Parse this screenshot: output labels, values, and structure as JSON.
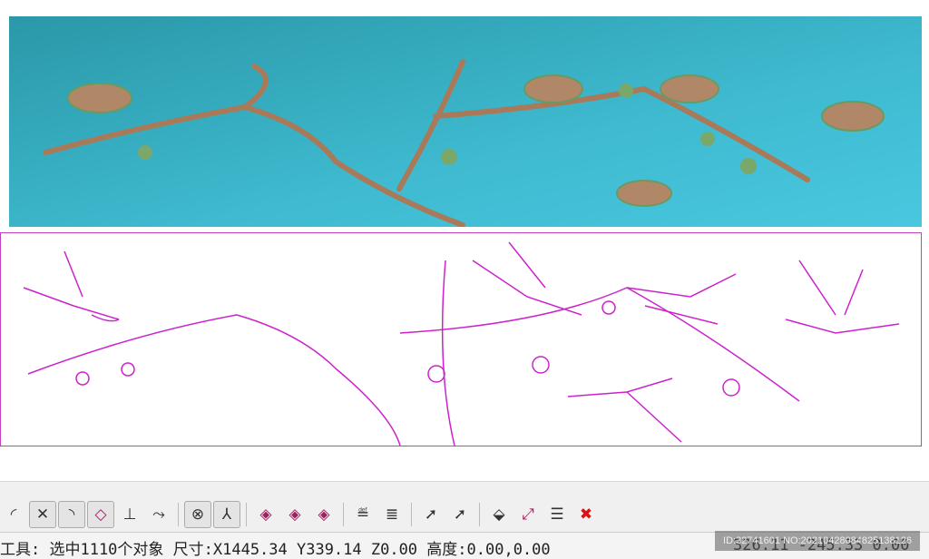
{
  "toolbar": {
    "tools": [
      {
        "icon": "arc-icon",
        "glyph": "◜"
      },
      {
        "icon": "intersect-icon",
        "glyph": "✕"
      },
      {
        "icon": "fillet-icon",
        "glyph": "◝"
      },
      {
        "icon": "circle-snap-icon",
        "glyph": "◇"
      },
      {
        "icon": "perpendicular-icon",
        "glyph": "⊥"
      },
      {
        "icon": "tangent-icon",
        "glyph": "⤳"
      },
      {
        "icon": "center-snap-icon",
        "glyph": "⊗"
      },
      {
        "icon": "axis-icon",
        "glyph": "⅄"
      },
      {
        "icon": "node-snap-1-icon",
        "glyph": "◈"
      },
      {
        "icon": "node-snap-2-icon",
        "glyph": "◈"
      },
      {
        "icon": "node-snap-3-icon",
        "glyph": "◈"
      },
      {
        "icon": "layer-down-icon",
        "glyph": "≝"
      },
      {
        "icon": "layer-stack-icon",
        "glyph": "≣"
      },
      {
        "icon": "select-point-icon",
        "glyph": "➚"
      },
      {
        "icon": "deselect-point-icon",
        "glyph": "➚"
      },
      {
        "icon": "project-icon",
        "glyph": "⬙"
      },
      {
        "icon": "node-edit-icon",
        "glyph": "⤢"
      },
      {
        "icon": "list-icon",
        "glyph": "☰"
      },
      {
        "icon": "delete-icon",
        "glyph": "✖"
      }
    ]
  },
  "status": {
    "left": "工具: 选中1110个对象 尺寸:X1445.34 Y339.14 Z0.00 高度:0.00,0.00",
    "right": "326.11 -245.33 0.00"
  },
  "watermark": "ID:32741601 NO:20210428084825138126",
  "colors": {
    "relief_bg": "#3aa8bc",
    "outline": "#cc22cc",
    "delete": "#dd1111"
  }
}
